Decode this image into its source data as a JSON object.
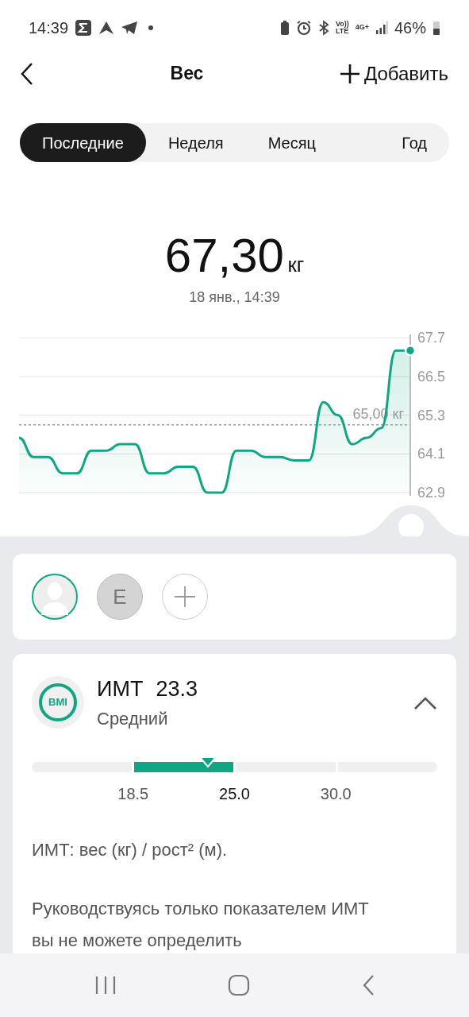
{
  "status_bar": {
    "time": "14:39",
    "volte_top": "Vo))",
    "volte_bottom": "LTE",
    "network": "4G+",
    "battery": "46%"
  },
  "header": {
    "title": "Вес",
    "add_label": "Добавить"
  },
  "tabs": [
    {
      "label": "Последние",
      "selected": true
    },
    {
      "label": "Неделя",
      "selected": false
    },
    {
      "label": "Месяц",
      "selected": false
    },
    {
      "label": "Год",
      "selected": false
    }
  ],
  "reading": {
    "value": "67,30",
    "unit": "кг",
    "date": "18 янв., 14:39"
  },
  "chart_data": {
    "type": "area",
    "grid": true,
    "ylim": [
      62.9,
      67.7
    ],
    "yticks": [
      67.7,
      66.5,
      65.3,
      64.1,
      62.9
    ],
    "series": [
      {
        "color": "#11a683",
        "values": [
          64.6,
          64.0,
          64.0,
          63.5,
          63.5,
          64.2,
          64.2,
          64.4,
          64.4,
          63.5,
          63.5,
          63.7,
          63.7,
          62.9,
          62.9,
          64.2,
          64.2,
          64.0,
          64.0,
          63.9,
          63.9,
          65.7,
          65.3,
          64.4,
          64.6,
          64.9,
          67.3,
          67.3
        ]
      }
    ],
    "ref_lines": [
      {
        "axis": "y",
        "value": 65.0,
        "label": "65,00 кг"
      }
    ]
  },
  "profiles": [
    {
      "kind": "photo",
      "selected": true
    },
    {
      "kind": "initial",
      "label": "E",
      "selected": false
    },
    {
      "kind": "add",
      "selected": false
    }
  ],
  "bmi": {
    "icon_label": "BMI",
    "label": "ИМТ",
    "value": "23.3",
    "category": "Средний",
    "expanded": true,
    "level": 0.434,
    "segments": [
      {
        "selected": false
      },
      {
        "selected": true
      },
      {
        "selected": false
      },
      {
        "selected": false
      }
    ],
    "thresholds": [
      {
        "label": "18.5",
        "selected": false
      },
      {
        "label": "25.0",
        "selected": true
      },
      {
        "label": "30.0",
        "selected": false
      }
    ],
    "formula": "ИМТ: вес (кг) / рост² (м).",
    "note": "Руководствуясь только показателем ИМТ вы не можете определить"
  }
}
